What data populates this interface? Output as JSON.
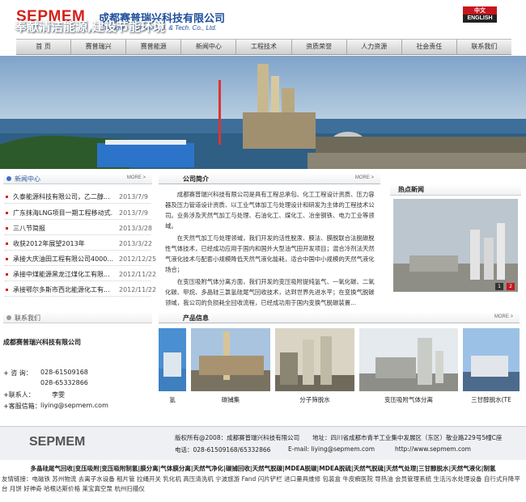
{
  "header": {
    "logo_en": "SEPMEM",
    "company_cn": "成都赛普瑞兴科技有限公司",
    "company_en": "Chengdu Sepmem Sci. & Tech. Co., Ltd.",
    "lang_cn": "中文",
    "lang_en": "ENGLISH"
  },
  "nav": [
    "首 页",
    "赛普瑞兴",
    "赛普能源",
    "新闻中心",
    "工程技术",
    "资质荣誉",
    "人力资源",
    "社会责任",
    "联系我们"
  ],
  "banner": {
    "slogan": "奉献清洁能源,建设节能环境"
  },
  "news": {
    "title": "新闻中心",
    "more": "MORE >",
    "items": [
      {
        "title": "久泰能源科技有限公司，乙二醇...",
        "date": "2013/7/9"
      },
      {
        "title": "广东抹海LNG项目一期工程移动式...",
        "date": "2013/7/9"
      },
      {
        "title": "三八节简报",
        "date": "2013/3/28"
      },
      {
        "title": "收获2012年展望2013年",
        "date": "2013/3/22"
      },
      {
        "title": "承接大庆油田工程有限公司4000...",
        "date": "2012/12/25"
      },
      {
        "title": "承接中煤能源黑龙江煤化工有限...",
        "date": "2012/11/22"
      },
      {
        "title": "承接鄂尔多斯市西北能源化工有...",
        "date": "2012/11/22"
      }
    ]
  },
  "intro": {
    "title": "公司简介",
    "more": "MORE >",
    "paragraphs": [
      "成都赛普瑞兴科技有限公司是具有工程总承包、化工工程设计资质、压力容器及压力管道设计资质、以工业气体加工与处理设计和研发为主体的工程技术公司。业务涉及天然气加工与处理、石油化工、煤化工、冶金钢铁、电力工业等领域。",
      "在天然气加工与处理领域，我们开发的活性脱汞、膜法、膜脱联合法脱碳脱性气体技术，已经成功应用于国内和国外大型油气田开发项目；混合冷剂法天然气液化技术与配套小规模降低天然气液化能耗，适合中国中小规模的天然气液化场合；",
      "在变压吸附气体分离方面，我们开发的变压吸附提纯氢气、一氧化碳、二氧化碳、甲烷、多晶硅三氯氢硅尾气回收技术，达到世界先进水平；在变换气脱碳领域，我公司的负损耗全回收流程，已经成功用于国内变换气脱碳装置..."
    ]
  },
  "hot": {
    "title": "热点新闻",
    "pager": [
      "1",
      "2"
    ]
  },
  "contact": {
    "title": "联系我们",
    "company": "成都赛普瑞兴科技有限公司",
    "phone_label": "+ 咨  询：",
    "phone1": "028-61509168",
    "phone2": "028-65332866",
    "contact_label": "+联系人：",
    "contact_name": "李雯",
    "email_label": "+客服信箱：",
    "email": "liying@sepmem.com"
  },
  "products": {
    "title": "产品信息",
    "more": "MORE >",
    "items": [
      "氢",
      "碳捕集",
      "分子筛脱水",
      "变压吸附气体分离",
      "三甘醇脱水(TE"
    ]
  },
  "footer": {
    "logo": "SEPMEM",
    "copyright": "版权所有@2008：成都赛普瑞兴科技有限公司",
    "address": "地址：四川省成都市青羊工业集中发展区（东区）敬业路229号5幢C座",
    "tel": "电话：028-61509168/65332866",
    "email": "E-mail: liying@sepmem.com",
    "website": "http://www.sepmem.com",
    "product_strip": "多晶硅尾气回收|变压吸附|变压吸附制氢|膜分离|气体膜分离|天然气净化|碳捕回收|天然气脱碳|MDEA脱碳|MDEA脱硫|天然气脱硫|天然气处理|三甘醇脱水|天然气液化|制氢",
    "friend_links": "友情链接：电磁铁  苏州物流  去离子水设备  租片管  拉绳开关  乳化机  高压清洗机  宁波旅游  Fand 闪片铲栏  进口量具维修  包装盒  牛皮癣医院  导热油  会员管理系统  生活污水处理设备  自行式升降平台  月饼  好神奇  哈根达斯价格  莱宝真空泵  杭州扫描仪"
  },
  "colors": {
    "brand_red": "#d4201b",
    "brand_blue": "#1d4e9c",
    "section_blue": "#2b5a9c"
  }
}
